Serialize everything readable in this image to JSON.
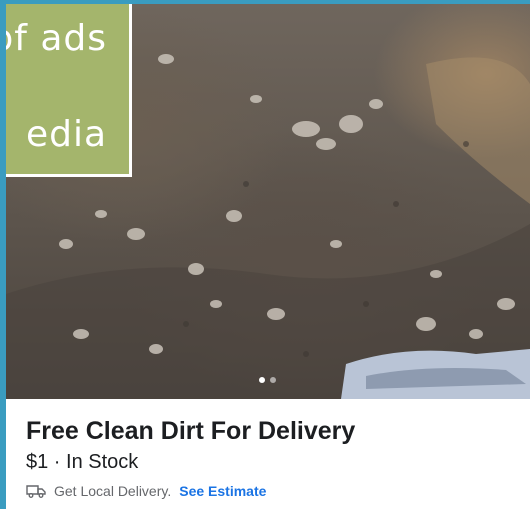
{
  "overlay": {
    "line1": "of ads",
    "line2": "edia"
  },
  "listing": {
    "title": "Free Clean Dirt For Delivery",
    "price_status": "$1 · In Stock",
    "delivery_text": "Get Local Delivery.",
    "estimate_link": "See Estimate"
  },
  "photo": {
    "image_count": 2,
    "active_index": 1
  },
  "icons": {
    "delivery": "delivery-truck-icon"
  },
  "colors": {
    "link": "#1b74e4",
    "overlay_bg": "#a4b56c",
    "page_bg": "#3a9cc0"
  }
}
